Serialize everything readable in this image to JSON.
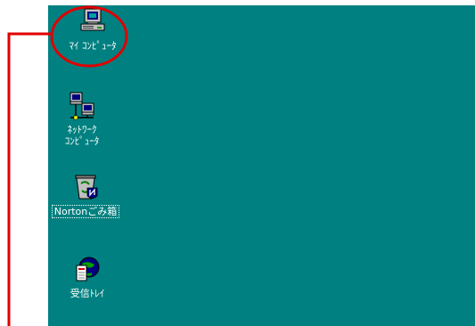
{
  "colors": {
    "desktop_bg": "#008080",
    "label_text": "#ffffff",
    "callout": "#e00000"
  },
  "desktop": {
    "icons": [
      {
        "label": "ﾏｲ ｺﾝﾋﾟｭｰﾀ",
        "icon": "computer-icon"
      },
      {
        "label": "ﾈｯﾄﾜｰｸ\nｺﾝﾋﾟｭｰﾀ",
        "icon": "network-icon"
      },
      {
        "label": "Nortonごみ箱",
        "icon": "recycle-bin-icon"
      },
      {
        "label": "受信ﾄﾚｲ",
        "icon": "inbox-icon"
      }
    ]
  }
}
